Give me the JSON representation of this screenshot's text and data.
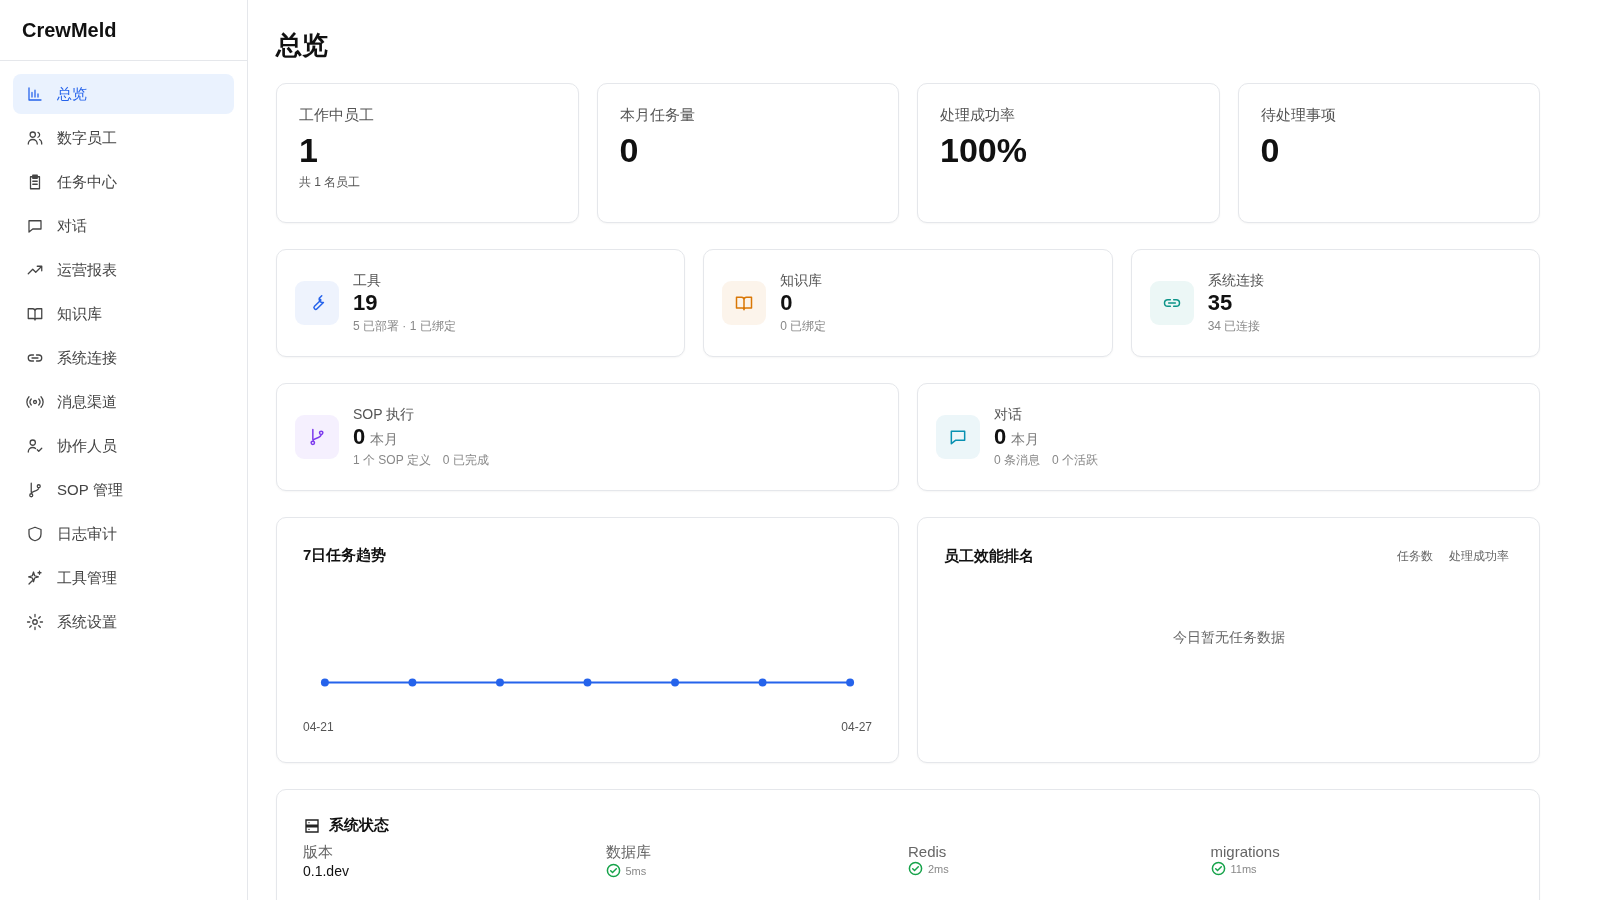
{
  "sidebar": {
    "brand": "CrewMeld",
    "items": [
      {
        "label": "总览",
        "selected": true
      },
      {
        "label": "数字员工",
        "selected": false
      },
      {
        "label": "任务中心",
        "selected": false
      },
      {
        "label": "对话",
        "selected": false
      },
      {
        "label": "运营报表",
        "selected": false
      },
      {
        "label": "知识库",
        "selected": false
      },
      {
        "label": "系统连接",
        "selected": false
      },
      {
        "label": "消息渠道",
        "selected": false
      },
      {
        "label": "协作人员",
        "selected": false
      },
      {
        "label": "SOP 管理",
        "selected": false
      },
      {
        "label": "日志审计",
        "selected": false
      },
      {
        "label": "工具管理",
        "selected": false
      },
      {
        "label": "系统设置",
        "selected": false
      }
    ]
  },
  "page_title": "总览",
  "stats": [
    {
      "label": "工作中员工",
      "value": "1",
      "note": "共 1 名员工"
    },
    {
      "label": "本月任务量",
      "value": "0"
    },
    {
      "label": "处理成功率",
      "value": "100%"
    },
    {
      "label": "待处理事项",
      "value": "0"
    }
  ],
  "resources": [
    {
      "label": "工具",
      "value": "19",
      "notes": [
        "5 已部署 · 1 已绑定"
      ],
      "color": "#2563eb"
    },
    {
      "label": "知识库",
      "value": "0",
      "notes": [
        "0 已绑定"
      ],
      "color": "#d97706"
    },
    {
      "label": "系统连接",
      "value": "35",
      "notes": [
        "34 已连接"
      ],
      "color": "#0d9488"
    }
  ],
  "activity": [
    {
      "label": "SOP 执行",
      "value": "0",
      "unit": "本月",
      "notes": [
        "1 个 SOP 定义",
        "0 已完成"
      ],
      "color": "#7c3aed"
    },
    {
      "label": "对话",
      "value": "0",
      "unit": "本月",
      "notes": [
        "0 条消息",
        "0 个活跃"
      ],
      "color": "#0891b2"
    }
  ],
  "trend": {
    "title": "7日任务趋势",
    "x_start": "04-21",
    "x_end": "04-27"
  },
  "ranking": {
    "title": "员工效能排名",
    "options": [
      {
        "label": "任务数",
        "selected": false
      },
      {
        "label": "处理成功率",
        "selected": false
      }
    ],
    "empty": "今日暂无任务数据"
  },
  "system_status": {
    "title": "系统状态",
    "items": [
      {
        "label": "版本",
        "value": "0.1.dev",
        "kind": "text"
      },
      {
        "label": "数据库",
        "value": "5ms",
        "kind": "check",
        "ok": true
      },
      {
        "label": "Redis",
        "value": "2ms",
        "kind": "check",
        "ok": true
      },
      {
        "label": "migrations",
        "value": "11ms",
        "kind": "check",
        "ok": true
      }
    ]
  }
}
